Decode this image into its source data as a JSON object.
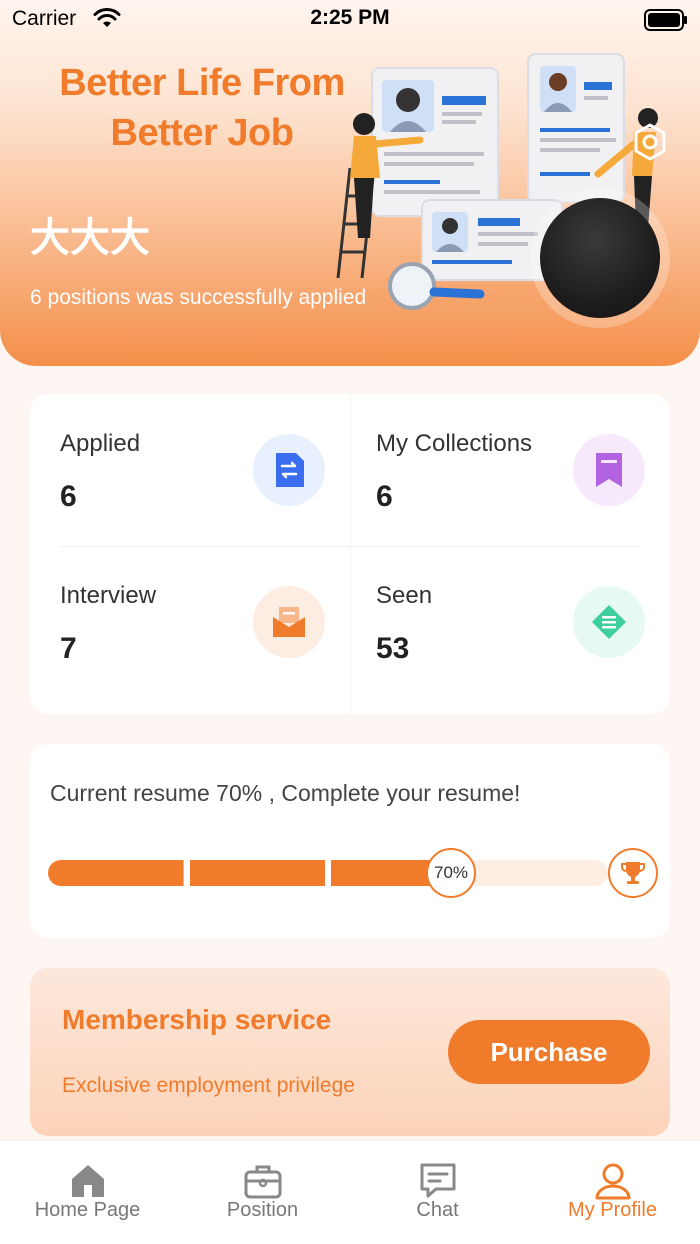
{
  "status_bar": {
    "carrier": "Carrier",
    "time": "2:25 PM"
  },
  "header": {
    "slogan_line1": "Better Life From",
    "slogan_line2": "Better Job",
    "username": "大大大",
    "applied_summary": "6 positions was successfully applied"
  },
  "stats": [
    {
      "label": "Applied",
      "value": "6",
      "icon": "swap-doc-icon",
      "color": "#3a6df0"
    },
    {
      "label": "My Collections",
      "value": "6",
      "icon": "bookmark-icon",
      "color": "#b362e0"
    },
    {
      "label": "Interview",
      "value": "7",
      "icon": "mail-icon",
      "color": "#f07b2a"
    },
    {
      "label": "Seen",
      "value": "53",
      "icon": "list-diamond-icon",
      "color": "#3fcf9e"
    }
  ],
  "resume": {
    "text": "Current resume 70% , Complete your resume!",
    "progress": 0.7,
    "badge": "70%"
  },
  "membership": {
    "title": "Membership service",
    "subtitle": "Exclusive employment privilege",
    "button": "Purchase"
  },
  "tabs": [
    {
      "label": "Home Page",
      "icon": "home-icon"
    },
    {
      "label": "Position",
      "icon": "briefcase-icon"
    },
    {
      "label": "Chat",
      "icon": "chat-icon"
    },
    {
      "label": "My Profile",
      "icon": "profile-icon",
      "active": true
    }
  ],
  "colors": {
    "accent": "#f07b2a",
    "track": "#fdeee4"
  }
}
